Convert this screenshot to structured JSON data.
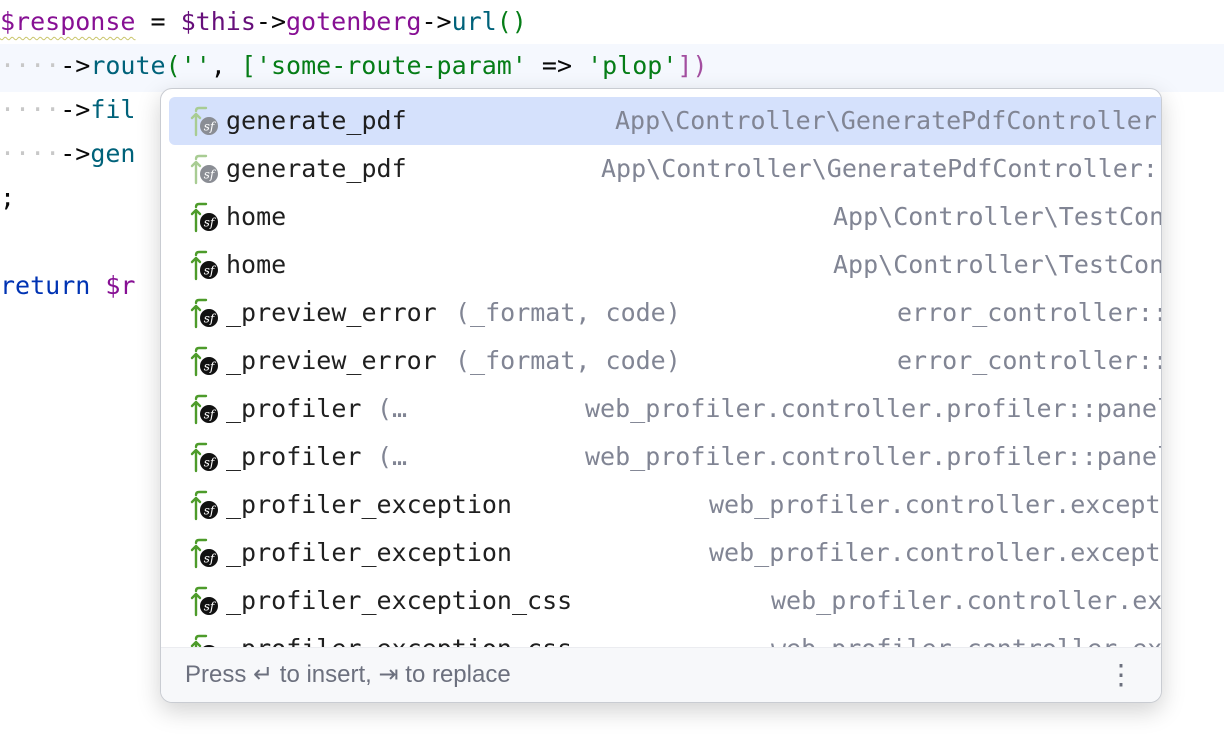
{
  "editor": {
    "lines": [
      {
        "a": "$response",
        "b": " = ",
        "c": "$this",
        "d": "->",
        "e": "gotenberg",
        "f": "->",
        "g": "url",
        "h": "()"
      },
      {
        "ws": "····",
        "arrow": "->",
        "method": "route",
        "open": "(",
        "s1": "''",
        "comma": ", ",
        "lb": "[",
        "s2": "'some-route-param'",
        "fat": " => ",
        "s3": "'plop'",
        "rb": "]",
        "close": ")"
      },
      {
        "ws": "····",
        "arrow": "->",
        "method": "fil"
      },
      {
        "ws": "····",
        "arrow": "->",
        "method": "gen"
      },
      {
        "text": ";"
      },
      {
        "kw": "return",
        "rest": " $r"
      }
    ]
  },
  "completion": {
    "items": [
      {
        "name": "generate_pdf",
        "params": "",
        "tail": "App\\Controller\\GeneratePdfController::__invoke",
        "selected": true,
        "icon": "symfony-route-icon-faded"
      },
      {
        "name": "generate_pdf",
        "params": "",
        "tail": "App\\Controller\\GeneratePdfController::__inv…/…",
        "selected": false,
        "icon": "symfony-route-icon-faded"
      },
      {
        "name": "home",
        "params": "",
        "tail": "App\\Controller\\TestControlle:r",
        "selected": false,
        "icon": "symfony-route-icon"
      },
      {
        "name": "home",
        "params": "",
        "tail": "App\\Controller\\TestControlle:r",
        "selected": false,
        "icon": "symfony-route-icon"
      },
      {
        "name": "_preview_error",
        "params": "(_format, code)",
        "tail": "error_controller::preview:w",
        "selected": false,
        "icon": "symfony-route-icon"
      },
      {
        "name": "_preview_error",
        "params": "(_format, code)",
        "tail": "error_controller::preview:w",
        "selected": false,
        "icon": "symfony-route-icon"
      },
      {
        "name": "_profiler",
        "params": "(…",
        "tail": "web_profiler.controller.profiler::panelAction:n",
        "selected": false,
        "icon": "symfony-route-icon"
      },
      {
        "name": "_profiler",
        "params": "(…",
        "tail": "web_profiler.controller.profiler::panelAction:n",
        "selected": false,
        "icon": "symfony-route-icon"
      },
      {
        "name": "_profiler_exception",
        "params": "",
        "tail": "web_profiler.controller.exception_pa…:…",
        "selected": false,
        "icon": "symfony-route-icon"
      },
      {
        "name": "_profiler_exception",
        "params": "",
        "tail": "web_profiler.controller.exception_pa…:…",
        "selected": false,
        "icon": "symfony-route-icon"
      },
      {
        "name": "_profiler_exception_css",
        "params": "",
        "tail": "web_profiler.controller.exceptio…:…",
        "selected": false,
        "icon": "symfony-route-icon"
      },
      {
        "name": "_profiler_exception_css",
        "params": "",
        "tail": "web_profiler.controller.exceptio…:…",
        "selected": false,
        "icon": "symfony-route-icon"
      }
    ],
    "footer_hint": "Press ↵ to insert, ⇥ to replace",
    "more_icon": "⋮"
  }
}
